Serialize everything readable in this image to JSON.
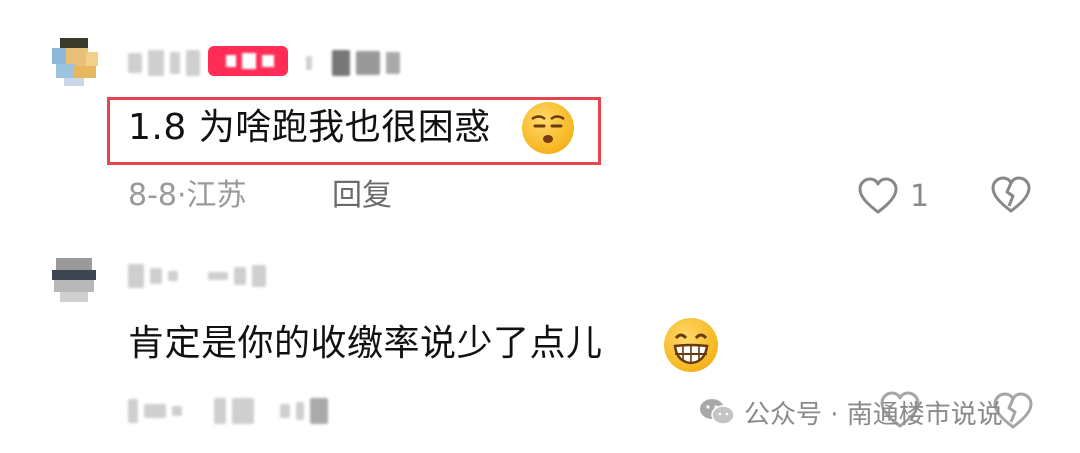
{
  "comments": [
    {
      "text": "1.8 为啥跑我也很困惑",
      "date": "8-8",
      "separator": "·",
      "location": "江苏",
      "reply_label": "回复",
      "like_count": "1",
      "emoji": "smirking-face"
    },
    {
      "text": "肯定是你的收缴率说少了点儿",
      "emoji": "grinning-face"
    }
  ],
  "watermark": {
    "text": "公众号 · 南通楼市说说",
    "icon": "wechat-icon"
  },
  "colors": {
    "highlight_border": "#e8444f",
    "tag": "#ff2d55",
    "meta_text": "#9a9a9a"
  }
}
